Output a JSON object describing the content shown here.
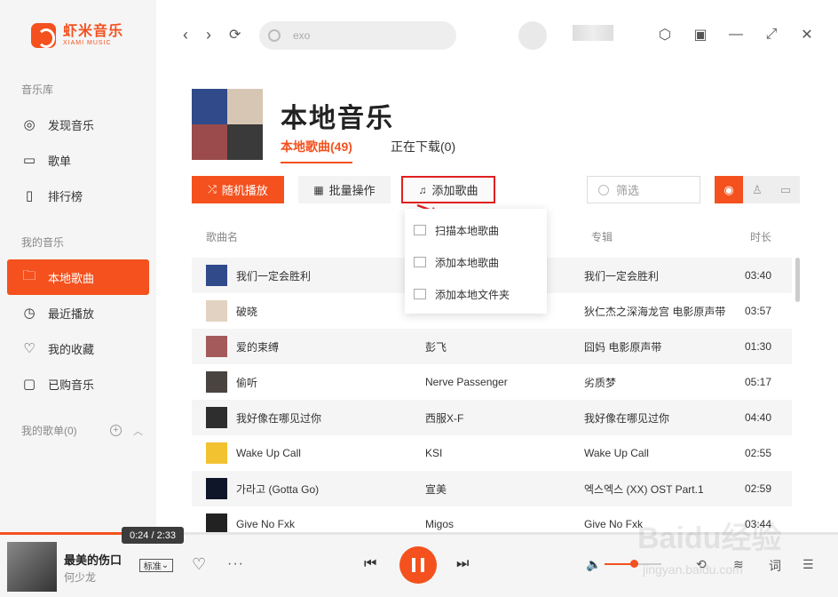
{
  "app": {
    "name_cn": "虾米音乐",
    "name_en": "XIAMI MUSIC"
  },
  "sidebar": {
    "section_library": "音乐库",
    "library_items": [
      {
        "label": "发现音乐",
        "icon": "disc-icon"
      },
      {
        "label": "歌单",
        "icon": "playlist-icon"
      },
      {
        "label": "排行榜",
        "icon": "chart-bars-icon"
      }
    ],
    "section_mine": "我的音乐",
    "mine_items": [
      {
        "label": "本地歌曲",
        "icon": "folder-icon",
        "active": true
      },
      {
        "label": "最近播放",
        "icon": "clock-icon"
      },
      {
        "label": "我的收藏",
        "icon": "heart-icon"
      },
      {
        "label": "已购音乐",
        "icon": "purchased-icon"
      }
    ],
    "playlists_label": "我的歌单(0)"
  },
  "topbar": {
    "search_placeholder": "exo"
  },
  "header": {
    "title": "本地音乐",
    "tabs": [
      {
        "label": "本地歌曲(49)"
      },
      {
        "label": "正在下载(0)"
      }
    ]
  },
  "toolbar": {
    "shuffle": "随机播放",
    "batch": "批量操作",
    "add_songs": "添加歌曲",
    "filter_placeholder": "筛选"
  },
  "dropdown": {
    "items": [
      "扫描本地歌曲",
      "添加本地歌曲",
      "添加本地文件夹"
    ]
  },
  "table": {
    "columns": {
      "name": "歌曲名",
      "album": "专辑",
      "duration": "时长"
    },
    "rows": [
      {
        "name": "我们一定会胜利",
        "artist": "",
        "album": "我们一定会胜利",
        "duration": "03:40"
      },
      {
        "name": "破晓",
        "artist": "",
        "album": "狄仁杰之深海龙宫 电影原声带",
        "duration": "03:57"
      },
      {
        "name": "爱的束缚",
        "artist": "彭飞",
        "album": "囧妈 电影原声带",
        "duration": "01:30"
      },
      {
        "name": "偷听",
        "artist": "Nerve Passenger",
        "album": "劣质梦",
        "duration": "05:17"
      },
      {
        "name": "我好像在哪见过你",
        "artist": "西服X-F",
        "album": "我好像在哪见过你",
        "duration": "04:40"
      },
      {
        "name": "Wake Up Call",
        "artist": "KSI",
        "album": "Wake Up Call",
        "duration": "02:55"
      },
      {
        "name": "가라고 (Gotta Go)",
        "artist": "宣美",
        "album": "엑스엑스 (XX) OST Part.1",
        "duration": "02:59"
      },
      {
        "name": "Give No Fxk",
        "artist": "Migos",
        "album": "Give No Fxk",
        "duration": "03:44"
      }
    ]
  },
  "player": {
    "time_tip": "0:24 / 2:33",
    "progress": 0.156,
    "song_title": "最美的伤口",
    "song_artist": "何少龙",
    "quality": "标准",
    "volume": 0.5
  },
  "watermark": {
    "main": "Baidu经验",
    "sub": "jingyan.baidu.com"
  }
}
